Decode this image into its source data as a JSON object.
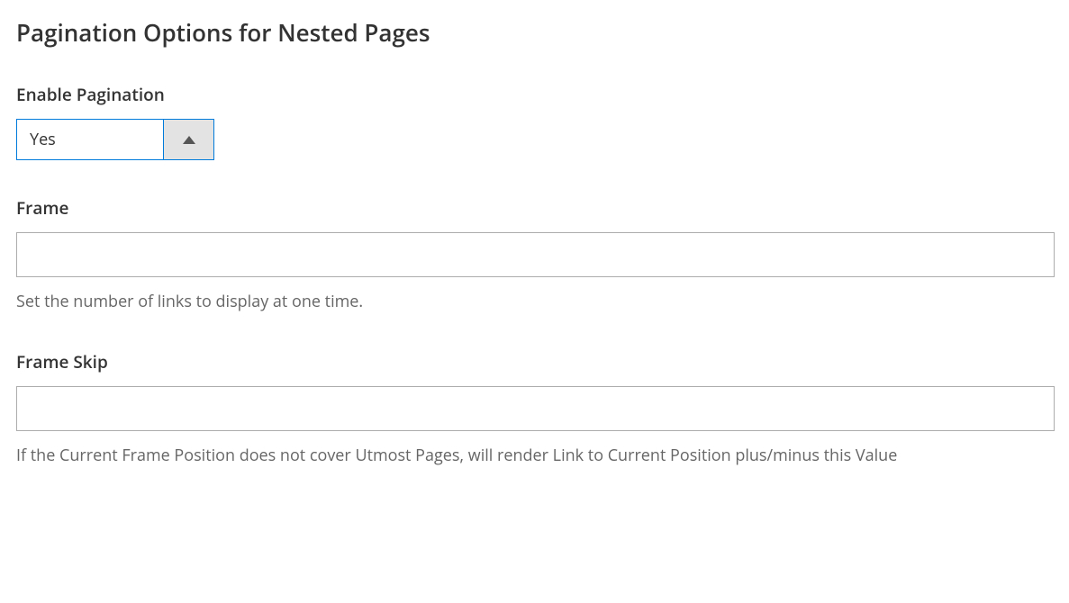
{
  "title": "Pagination Options for Nested Pages",
  "fields": {
    "enablePagination": {
      "label": "Enable Pagination",
      "value": "Yes"
    },
    "frame": {
      "label": "Frame",
      "value": "",
      "help": "Set the number of links to display at one time."
    },
    "frameSkip": {
      "label": "Frame Skip",
      "value": "",
      "help": "If the Current Frame Position does not cover Utmost Pages, will render Link to Current Position plus/minus this Value"
    }
  }
}
